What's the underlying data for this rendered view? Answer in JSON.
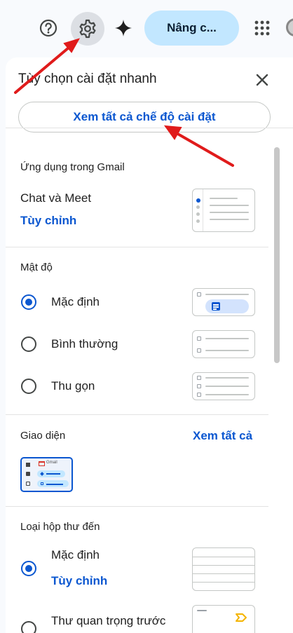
{
  "topbar": {
    "upgrade_label": "Nâng c...",
    "icons": [
      "help-icon",
      "gear-icon",
      "gemini-spark-icon",
      "apps-grid-icon"
    ]
  },
  "panel": {
    "title": "Tùy chọn cài đặt nhanh",
    "all_settings_label": "Xem tất cả chế độ cài đặt",
    "apps": {
      "title": "Ứng dụng trong Gmail",
      "chat_meet_label": "Chat và Meet",
      "customize_label": "Tùy chỉnh"
    },
    "density": {
      "title": "Mật độ",
      "options": [
        {
          "label": "Mặc định",
          "selected": true
        },
        {
          "label": "Bình thường",
          "selected": false
        },
        {
          "label": "Thu gọn",
          "selected": false
        }
      ]
    },
    "theme": {
      "title": "Giao diện",
      "view_all_label": "Xem tất cả",
      "thumb_brand": "Gmail"
    },
    "inbox_type": {
      "title": "Loại hộp thư đến",
      "options": [
        {
          "label": "Mặc định",
          "selected": true,
          "customize_label": "Tùy chỉnh"
        },
        {
          "label": "Thư quan trọng trước",
          "selected": false
        }
      ]
    }
  },
  "colors": {
    "accent": "#0b57d0",
    "selected_pill": "#c2e7ff",
    "annotation_arrow": "#e01b1b"
  }
}
